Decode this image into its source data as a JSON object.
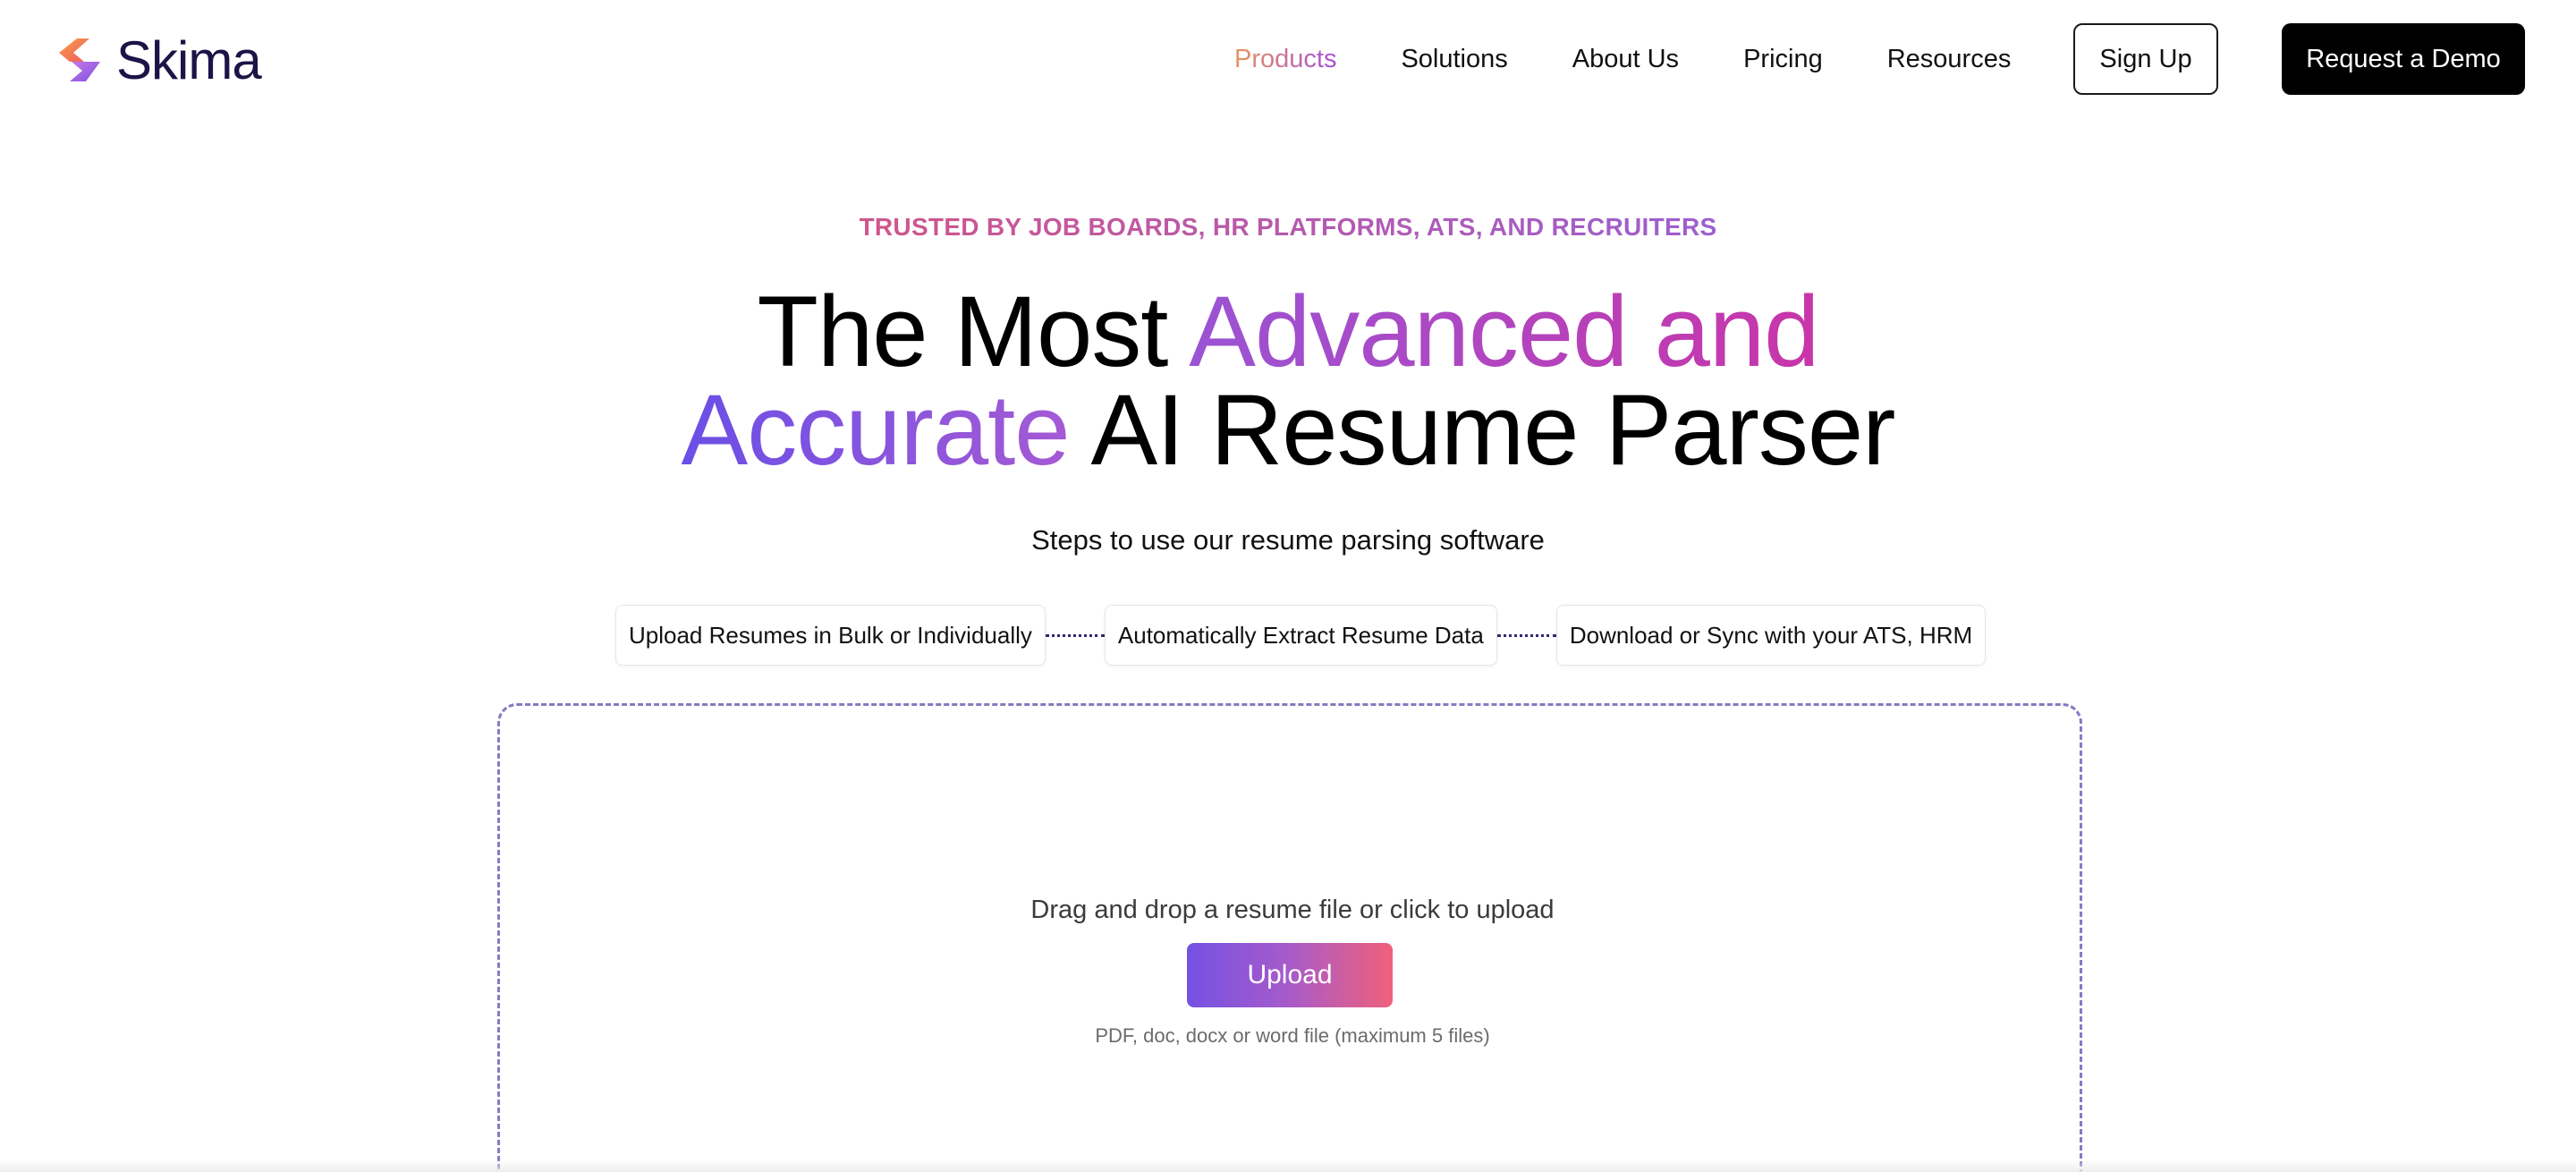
{
  "brand": {
    "name": "Skima",
    "logo_colors": [
      "#f26b4a",
      "#a064e0"
    ]
  },
  "nav": {
    "items": [
      {
        "label": "Products",
        "active": true
      },
      {
        "label": "Solutions",
        "active": false
      },
      {
        "label": "About Us",
        "active": false
      },
      {
        "label": "Pricing",
        "active": false
      },
      {
        "label": "Resources",
        "active": false
      }
    ],
    "signup_label": "Sign Up",
    "demo_label": "Request a Demo"
  },
  "hero": {
    "eyebrow": "TRUSTED BY JOB BOARDS, HR PLATFORMS, ATS, AND RECRUITERS",
    "headline": {
      "part1": "The Most ",
      "part2": "Advanced and",
      "part3": "Accurate",
      "part4": " AI Resume Parser"
    },
    "subhead": "Steps to use our resume parsing software"
  },
  "steps": [
    "Upload Resumes in Bulk or Individually",
    "Automatically Extract Resume Data",
    "Download or Sync with your ATS, HRM"
  ],
  "upload": {
    "prompt": "Drag and drop a resume file or click to upload",
    "button_label": "Upload",
    "note": "PDF, doc, docx or word file (maximum 5 files)"
  },
  "colors": {
    "accent_orange": "#e4965a",
    "accent_purple": "#a84fd8",
    "accent_pink": "#c935a9",
    "dash_border": "#8a78c2"
  }
}
